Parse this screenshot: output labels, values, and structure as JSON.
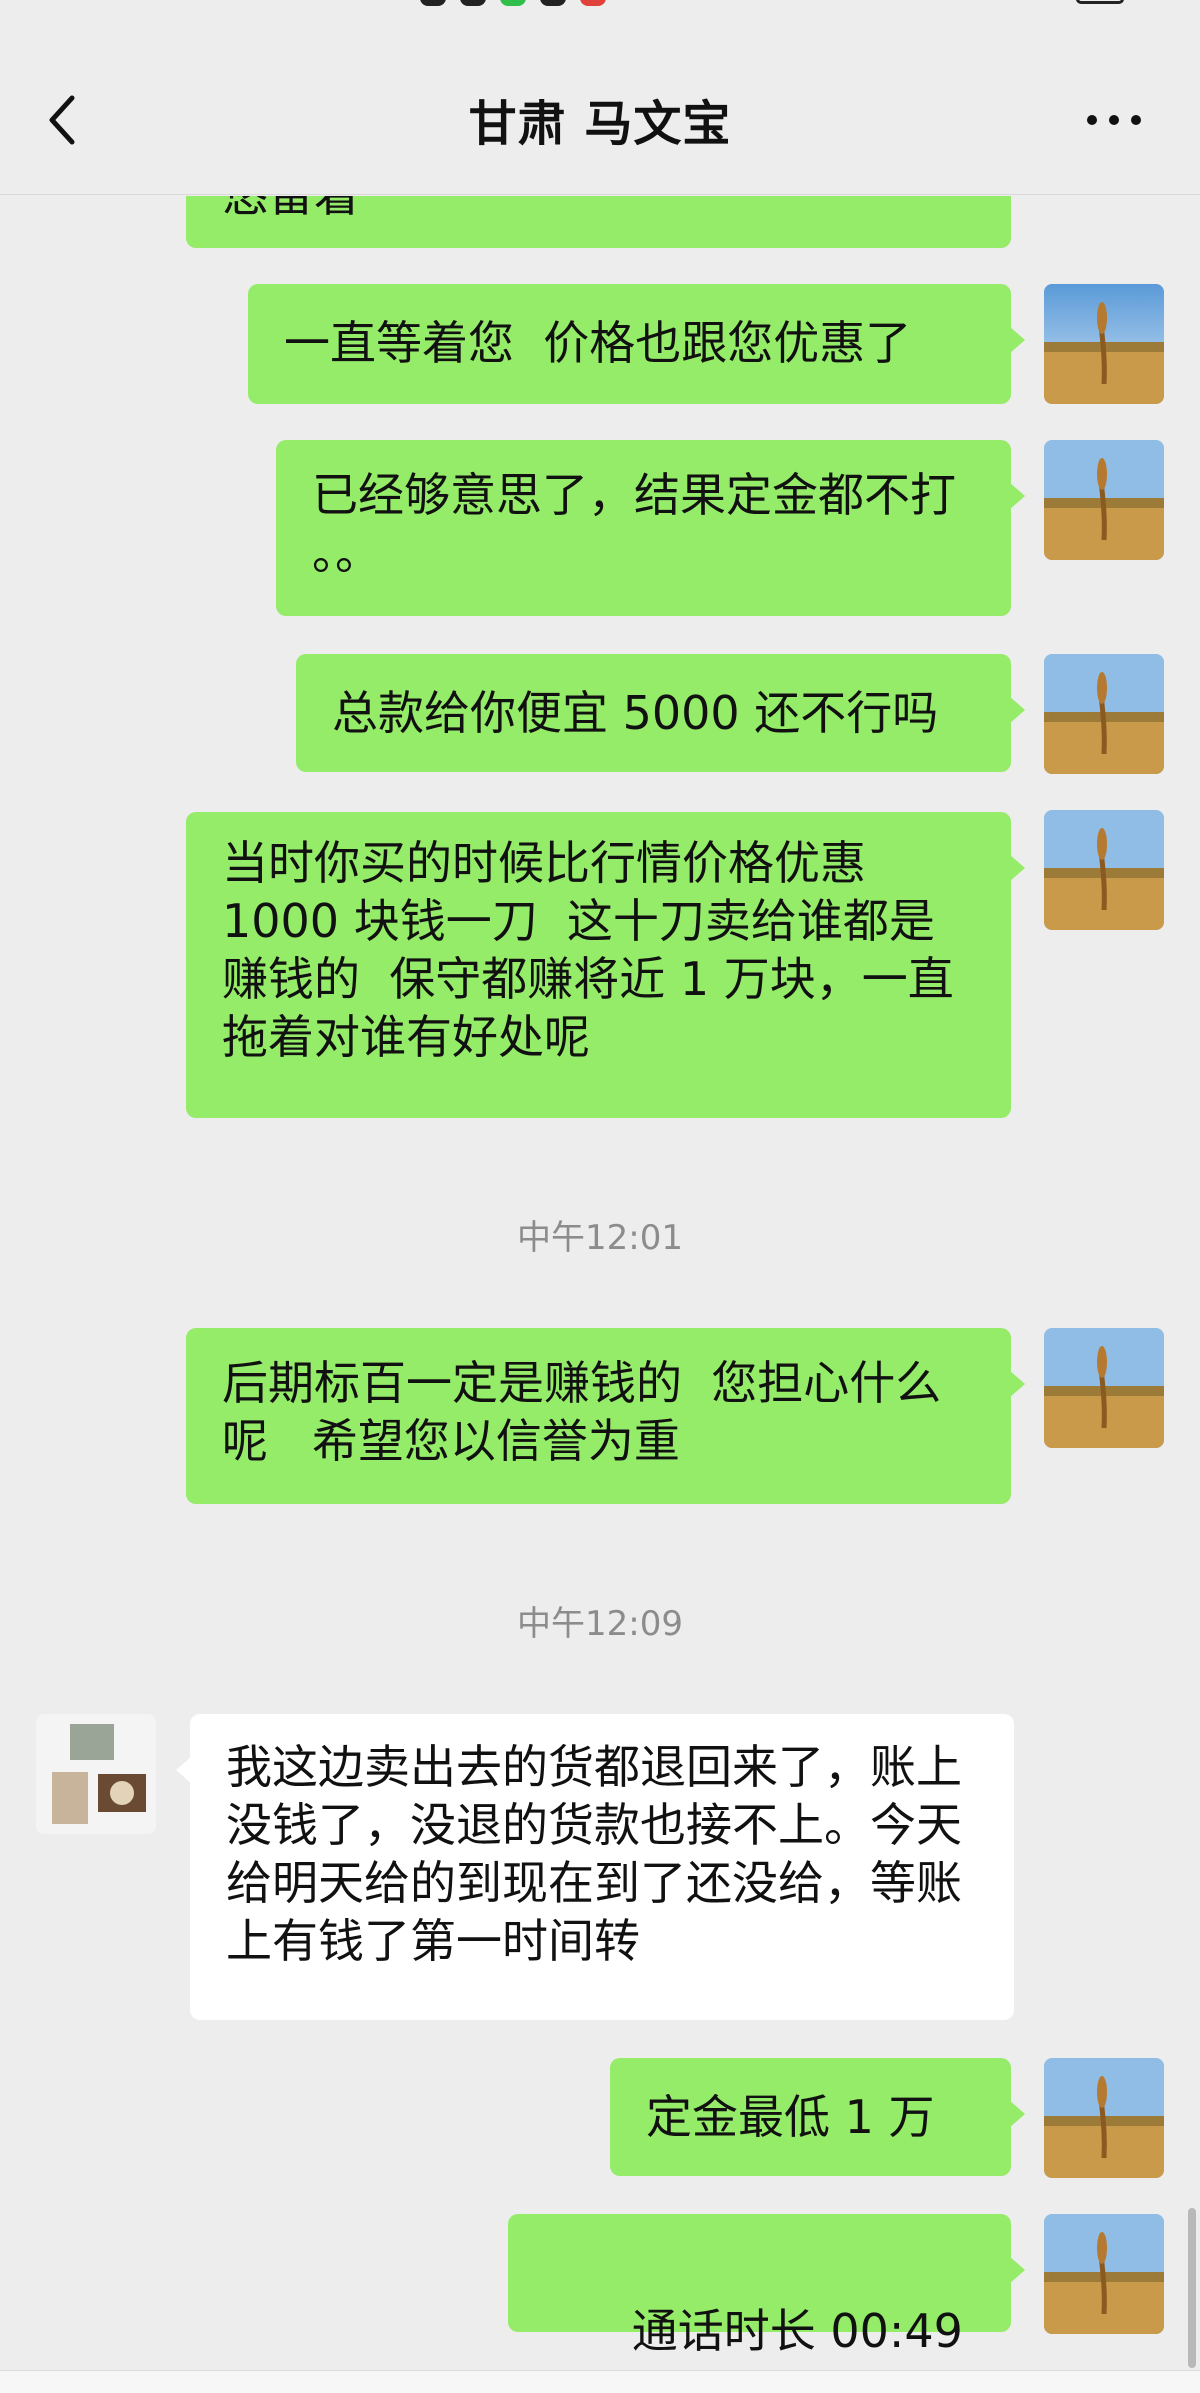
{
  "header": {
    "title": "甘肃 马文宝"
  },
  "messages": [
    {
      "side": "me",
      "text": "悠留着"
    },
    {
      "side": "me",
      "text": "一直等着您  价格也跟您优惠了"
    },
    {
      "side": "me",
      "text": "已经够意思了，结果定金都不打 。。"
    },
    {
      "side": "me",
      "text": "总款给你便宜 5000 还不行吗"
    },
    {
      "side": "me",
      "text": "当时你买的时候比行情价格优惠 1000 块钱一刀  这十刀卖给谁都是赚钱的  保守都赚将近 1 万块，一直拖着对谁有好处呢"
    },
    {
      "side": "me",
      "text": "后期标百一定是赚钱的  您担心什么呢   希望您以信誉为重"
    },
    {
      "side": "other",
      "text": "我这边卖出去的货都退回来了，账上没钱了，没退的货款也接不上。今天给明天给的到现在到了还没给，等账上有钱了第一时间转"
    },
    {
      "side": "me",
      "text": "定金最低 1 万"
    },
    {
      "side": "me",
      "text": "通话时长 00:49"
    }
  ],
  "timestamps": [
    "中午12:01",
    "中午12:09"
  ],
  "icons": {
    "back": "chevron-left-icon",
    "more": "more-dots-icon",
    "call": "phone-hangup-icon"
  },
  "colors": {
    "my_bubble": "#95ec69",
    "their_bubble": "#ffffff",
    "background": "#ededed"
  }
}
